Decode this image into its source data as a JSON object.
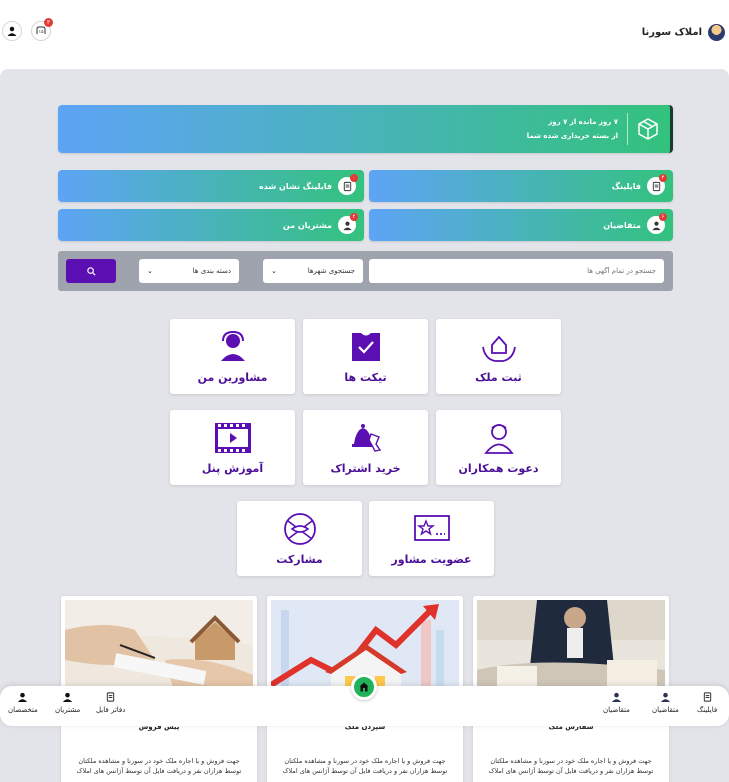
{
  "header": {
    "brand_name": "املاک سورنا",
    "notification_count": "۳"
  },
  "banner": {
    "line1": "۷ روز مانده از ۷ روز",
    "line2": "از بسته خریداری شده شما"
  },
  "stats": [
    {
      "label": "فایلینگ",
      "badge": "۴"
    },
    {
      "label": "فایلینگ نشان شده",
      "badge": "۰"
    },
    {
      "label": "متقاضیان",
      "badge": "۶"
    },
    {
      "label": "مشتریان من",
      "badge": "۴"
    }
  ],
  "search": {
    "placeholder": "جستجو در تمام آگهی ها",
    "city_select": "جستجوی شهرها",
    "category_select": "دسته بندی ها"
  },
  "tiles": [
    {
      "label": "ثبت ملک",
      "icon": "house-hands-icon"
    },
    {
      "label": "تیکت ها",
      "icon": "ticket-icon"
    },
    {
      "label": "مشاورین من",
      "icon": "headset-icon"
    },
    {
      "label": "دعوت همکاران",
      "icon": "invite-user-icon"
    },
    {
      "label": "خرید اشتراک",
      "icon": "bell-click-icon"
    },
    {
      "label": "آموزش پنل",
      "icon": "video-icon"
    },
    {
      "label": "عضویت مشاور",
      "icon": "star-card-icon"
    },
    {
      "label": "مشارکت",
      "icon": "handshake-icon"
    }
  ],
  "cards": [
    {
      "title": "سفارش ملک",
      "desc": "جهت فروش و یا اجاره ملک خود در سورنا و مشاهده ملکتان توسط هزاران نفر و دریافت فایل آن توسط آژانس های املاک"
    },
    {
      "title": "سپردن ملک",
      "desc": "جهت فروش و یا اجاره ملک خود در سورنا و مشاهده ملکتان توسط هزاران نفر و دریافت فایل آن توسط آژانس های املاک"
    },
    {
      "title": "پیش فروش",
      "desc": "جهت فروش و یا اجاره ملک خود در سورنا و مشاهده ملکتان توسط هزاران نفر و دریافت فایل آن توسط آژانس های املاک"
    }
  ],
  "bottom_nav": {
    "right": [
      "فایلینگ",
      "متقاضیان",
      "متقاضیان"
    ],
    "left": [
      "دفاتر فایل",
      "مشتریان",
      "متخصصان"
    ]
  },
  "colors": {
    "accent": "#5b0fb3",
    "tile_text": "#4a0f96",
    "gradient_start": "#5ea4f6",
    "gradient_end": "#33c27d",
    "home": "#22b35a"
  }
}
